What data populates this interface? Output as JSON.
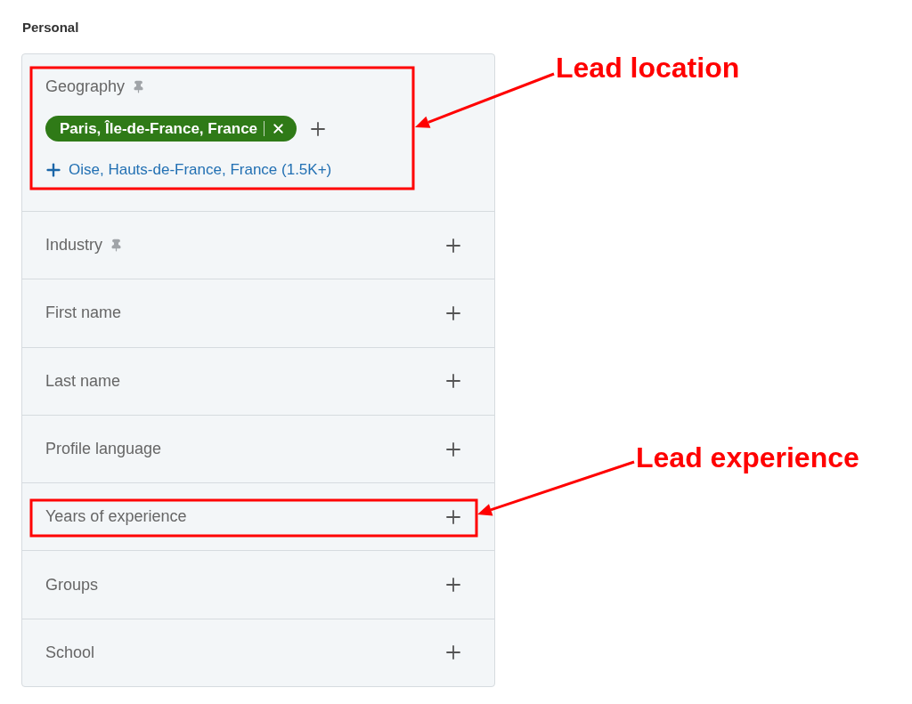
{
  "section_title": "Personal",
  "filters": [
    {
      "kind": "expanded",
      "label": "Geography",
      "pinned": true,
      "selected_chip": {
        "label": "Paris, Île-de-France, France"
      },
      "suggestion": {
        "label": "Oise, Hauts-de-France, France",
        "count": "(1.5K+)"
      }
    },
    {
      "kind": "collapsed",
      "label": "Industry",
      "pinned": true
    },
    {
      "kind": "collapsed",
      "label": "First name",
      "pinned": false
    },
    {
      "kind": "collapsed",
      "label": "Last name",
      "pinned": false
    },
    {
      "kind": "collapsed",
      "label": "Profile language",
      "pinned": false
    },
    {
      "kind": "collapsed",
      "label": "Years of experience",
      "pinned": false
    },
    {
      "kind": "collapsed",
      "label": "Groups",
      "pinned": false
    },
    {
      "kind": "collapsed",
      "label": "School",
      "pinned": false
    }
  ],
  "annotations": [
    {
      "label": "Lead location"
    },
    {
      "label": "Lead experience"
    }
  ]
}
